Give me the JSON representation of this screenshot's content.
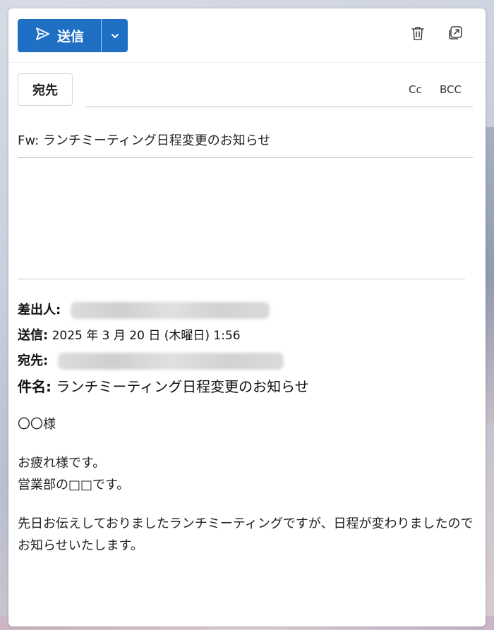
{
  "toolbar": {
    "send_label": "送信",
    "icons": [
      "send-icon",
      "chevron-down-icon",
      "trash-icon",
      "popout-icon"
    ]
  },
  "recipients": {
    "to_label": "宛先",
    "to_value": "",
    "cc_label": "Cc",
    "bcc_label": "BCC"
  },
  "subject": "Fw: ランチミーティング日程変更のお知らせ",
  "forwarded": {
    "from_label": "差出人:",
    "sent_label": "送信:",
    "sent_value": " 2025 年 3 月 20 日 (木曜日) 1:56",
    "to_label": "宛先:",
    "subject_label": "件名:",
    "subject_value": " ランチミーティング日程変更のお知らせ"
  },
  "body": {
    "greeting": "〇〇様",
    "line1": "お疲れ様です。",
    "line2": "営業部の□□です。",
    "line3": "先日お伝えしておりましたランチミーティングですが、日程が変わりましたのでお知らせいたします。"
  },
  "colors": {
    "accent": "#1f6fc5"
  }
}
